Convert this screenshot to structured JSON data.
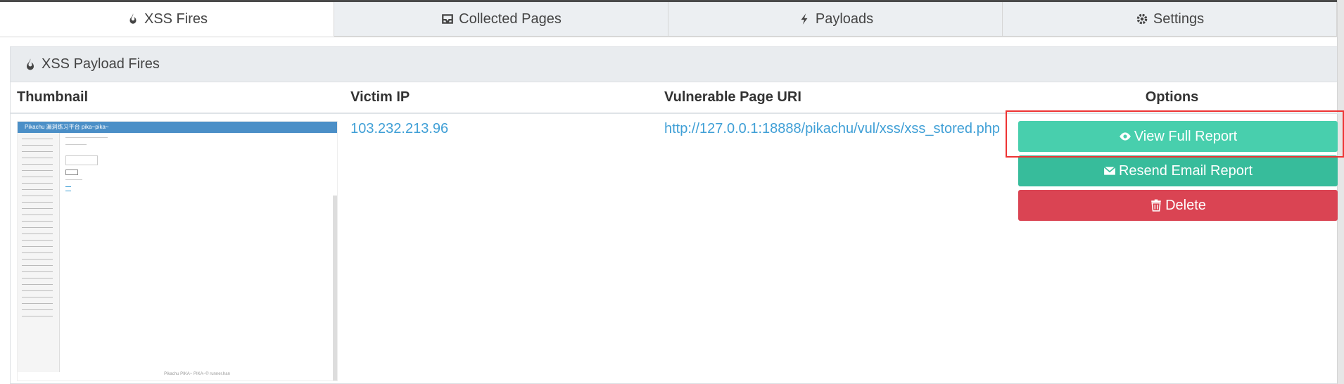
{
  "tabs": [
    {
      "label": "XSS Fires",
      "icon": "fire-icon",
      "active": true
    },
    {
      "label": "Collected Pages",
      "icon": "inbox-icon",
      "active": false
    },
    {
      "label": "Payloads",
      "icon": "bolt-icon",
      "active": false
    },
    {
      "label": "Settings",
      "icon": "gear-icon",
      "active": false
    }
  ],
  "panel": {
    "title": "XSS Payload Fires",
    "icon": "fire-icon"
  },
  "table": {
    "headers": [
      "Thumbnail",
      "Victim IP",
      "Vulnerable Page URI",
      "Options"
    ],
    "rows": [
      {
        "thumbnail": {
          "title_bar": "Pikachu 漏洞练习平台 pika~pika~",
          "footer": "Pikachu PIKA~ PIKA~© runner.han"
        },
        "victim_ip": "103.232.213.96",
        "uri": "http://127.0.0.1:18888/pikachu/vul/xss/xss_stored.php"
      }
    ]
  },
  "buttons": {
    "view": "View Full Report",
    "resend": "Resend Email Report",
    "delete": "Delete"
  },
  "colors": {
    "view": "#48cfad",
    "resend": "#37bc9b",
    "delete": "#da4453",
    "link": "#3f9fd6"
  }
}
